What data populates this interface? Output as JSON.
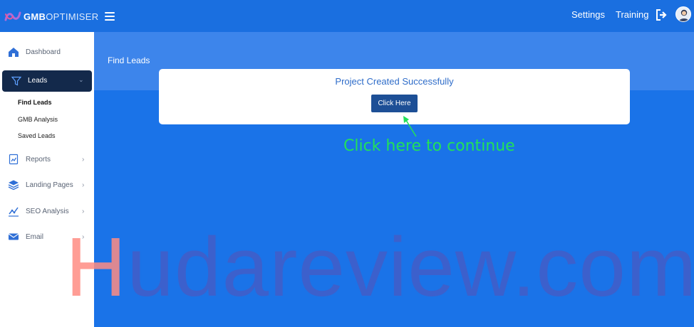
{
  "colors": {
    "topbar": "#1a6fe0",
    "main_bg": "#1a73e8",
    "active_nav": "#13294b",
    "button": "#1d4f96",
    "annotation": "#22e05a"
  },
  "app": {
    "logo_bold": "GMB",
    "logo_light": "OPTIMISER"
  },
  "topnav": {
    "settings": "Settings",
    "training": "Training"
  },
  "sidebar": {
    "items": [
      {
        "label": "Dashboard",
        "icon": "home-icon"
      },
      {
        "label": "Leads",
        "icon": "filter-icon",
        "active": true
      },
      {
        "label": "Reports",
        "icon": "report-icon"
      },
      {
        "label": "Landing Pages",
        "icon": "layers-icon"
      },
      {
        "label": "SEO Analysis",
        "icon": "chart-icon"
      },
      {
        "label": "Email",
        "icon": "mail-icon"
      }
    ],
    "sub_items": [
      {
        "label": "Find Leads",
        "active": true
      },
      {
        "label": "GMB Analysis"
      },
      {
        "label": "Saved Leads"
      }
    ]
  },
  "main": {
    "page_title": "Find Leads",
    "card": {
      "message": "Project Created Successfully",
      "button_label": "Click Here"
    },
    "annotation": "Click here to continue"
  },
  "watermark": {
    "first": "H",
    "rest": "udareview.com"
  }
}
